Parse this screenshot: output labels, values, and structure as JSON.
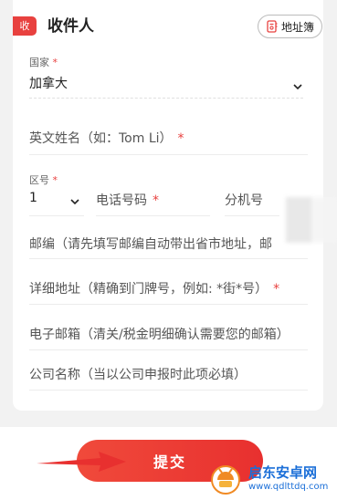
{
  "header": {
    "badge": "收",
    "title": "收件人",
    "address_book_label": "地址簿"
  },
  "form": {
    "country": {
      "label": "国家",
      "required_mark": "*",
      "value": "加拿大"
    },
    "english_name": {
      "placeholder": "英文姓名（如：Tom Li）",
      "required_mark": "*"
    },
    "area_code": {
      "label": "区号",
      "required_mark": "*",
      "value": "1"
    },
    "phone": {
      "placeholder": "电话号码",
      "required_mark": "*"
    },
    "extension": {
      "placeholder": "分机号"
    },
    "postcode": {
      "placeholder": "邮编（请先填写邮编自动带出省市地址，邮"
    },
    "address": {
      "placeholder": "详细地址（精确到门牌号，例如: *街*号）",
      "required_mark": "*"
    },
    "email": {
      "placeholder": "电子邮箱（清关/税金明细确认需要您的邮箱）"
    },
    "company": {
      "placeholder": "公司名称（当以公司申报时此项必填）"
    }
  },
  "footer": {
    "submit_label": "提交"
  },
  "watermark": {
    "title": "启东安卓网",
    "url": "www.qdlttdq.com"
  },
  "colors": {
    "accent": "#e8413f",
    "watermark": "#1b6fd8"
  },
  "icons": {
    "address_book": "address-book-icon",
    "dropdown": "chevron-down-icon",
    "pointer": "arrow-right-icon"
  }
}
